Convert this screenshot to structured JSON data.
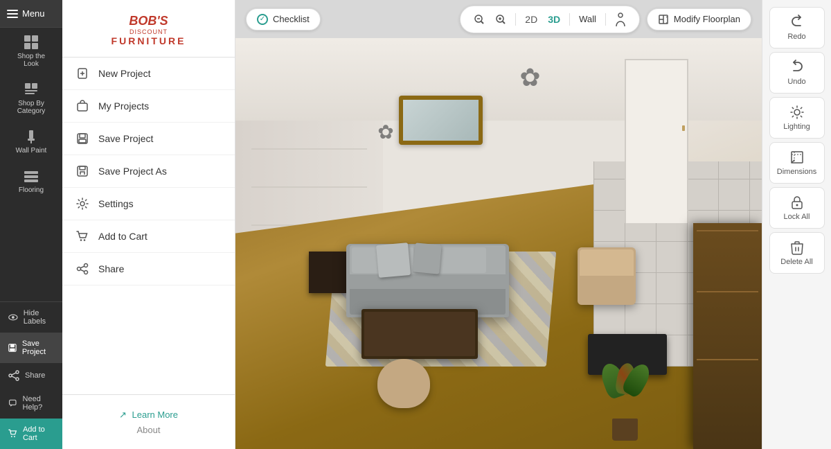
{
  "sidebar": {
    "menu_label": "Menu",
    "items": [
      {
        "id": "shop-the-look",
        "label": "Shop the\nLook",
        "icon": "grid-icon"
      },
      {
        "id": "shop-by-category",
        "label": "Shop By\nCategory",
        "icon": "category-icon"
      },
      {
        "id": "wall-paint",
        "label": "Wall Paint",
        "icon": "paint-icon"
      },
      {
        "id": "flooring",
        "label": "Flooring",
        "icon": "flooring-icon"
      }
    ],
    "bottom_items": [
      {
        "id": "hide-labels",
        "label": "Hide Labels",
        "icon": "eye-icon"
      },
      {
        "id": "save-project",
        "label": "Save Project",
        "icon": "save-icon"
      },
      {
        "id": "share",
        "label": "Share",
        "icon": "share-icon"
      },
      {
        "id": "need-help",
        "label": "Need Help?",
        "icon": "help-icon"
      },
      {
        "id": "add-to-cart",
        "label": "Add to Cart",
        "icon": "cart-icon",
        "is_teal": true
      }
    ]
  },
  "dropdown": {
    "logo": {
      "bobs": "BOB'S",
      "discount": "DISCOUNT",
      "furniture": "FURNITURE"
    },
    "menu_items": [
      {
        "id": "new-project",
        "label": "New Project",
        "icon": "new-project-icon"
      },
      {
        "id": "my-projects",
        "label": "My Projects",
        "icon": "my-projects-icon"
      },
      {
        "id": "save-project",
        "label": "Save Project",
        "icon": "save-project-icon"
      },
      {
        "id": "save-project-as",
        "label": "Save Project As",
        "icon": "save-as-icon"
      },
      {
        "id": "settings",
        "label": "Settings",
        "icon": "settings-icon"
      },
      {
        "id": "add-to-cart",
        "label": "Add to Cart",
        "icon": "cart-icon"
      },
      {
        "id": "share",
        "label": "Share",
        "icon": "share-icon"
      }
    ],
    "footer": {
      "learn_more_label": "Learn More",
      "about_label": "About"
    }
  },
  "topbar": {
    "checklist_label": "Checklist",
    "controls": {
      "zoom_out": "−",
      "zoom_in": "+",
      "view_2d": "2D",
      "view_3d": "3D",
      "wall_label": "Wall",
      "person_icon": "person-icon"
    },
    "modify_floorplan_label": "Modify Floorplan"
  },
  "right_panel": {
    "buttons": [
      {
        "id": "redo",
        "label": "Redo",
        "icon": "redo-icon"
      },
      {
        "id": "undo",
        "label": "Undo",
        "icon": "undo-icon"
      },
      {
        "id": "lighting",
        "label": "Lighting",
        "icon": "lighting-icon"
      },
      {
        "id": "dimensions",
        "label": "Dimensions",
        "icon": "dimensions-icon"
      },
      {
        "id": "lock-all",
        "label": "Lock All",
        "icon": "lock-icon"
      },
      {
        "id": "delete-all",
        "label": "Delete All",
        "icon": "delete-icon"
      }
    ]
  }
}
